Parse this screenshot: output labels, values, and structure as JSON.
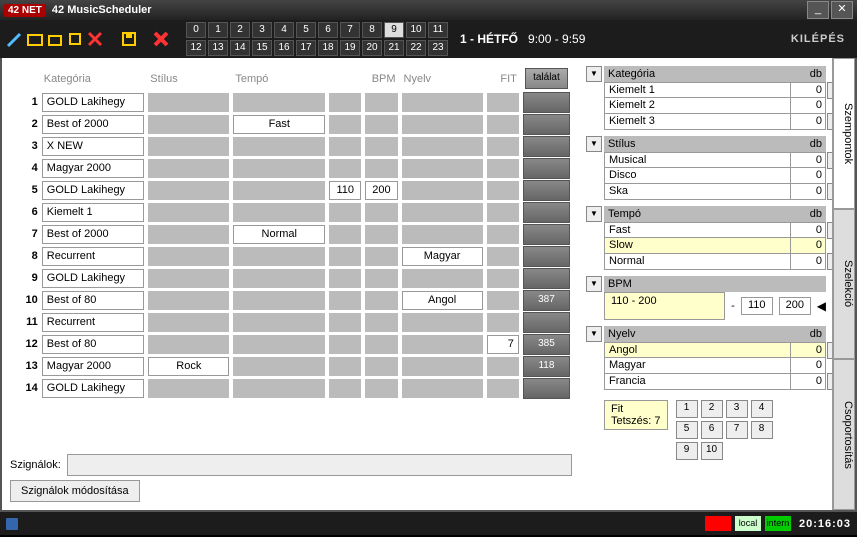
{
  "title": "42 MusicScheduler",
  "logo": "42 NET",
  "toolbar": {
    "exit": "KILÉPÉS"
  },
  "hours": {
    "selected": 9
  },
  "day": {
    "label": "1 - HÉTFŐ",
    "time": "9:00 - 9:59"
  },
  "columns": {
    "kat": "Kategória",
    "stilus": "Stílus",
    "tempo": "Tempó",
    "bpm": "BPM",
    "nyelv": "Nyelv",
    "fit": "FIT"
  },
  "result_header": "találat",
  "rows": [
    {
      "n": 1,
      "kat": "GOLD Lakihegy",
      "stilus": "",
      "tempo": "",
      "bpm": "",
      "bpm2": "",
      "nyelv": "",
      "fit": "",
      "res": ""
    },
    {
      "n": 2,
      "kat": "Best of 2000",
      "stilus": "",
      "tempo": "Fast",
      "bpm": "",
      "bpm2": "",
      "nyelv": "",
      "fit": "",
      "res": ""
    },
    {
      "n": 3,
      "kat": "X NEW",
      "stilus": "",
      "tempo": "",
      "bpm": "",
      "bpm2": "",
      "nyelv": "",
      "fit": "",
      "res": ""
    },
    {
      "n": 4,
      "kat": "Magyar 2000",
      "stilus": "",
      "tempo": "",
      "bpm": "",
      "bpm2": "",
      "nyelv": "",
      "fit": "",
      "res": ""
    },
    {
      "n": 5,
      "kat": "GOLD Lakihegy",
      "stilus": "",
      "tempo": "",
      "bpm": "110",
      "bpm2": "200",
      "nyelv": "",
      "fit": "",
      "res": ""
    },
    {
      "n": 6,
      "kat": "Kiemelt 1",
      "stilus": "",
      "tempo": "",
      "bpm": "",
      "bpm2": "",
      "nyelv": "",
      "fit": "",
      "res": ""
    },
    {
      "n": 7,
      "kat": "Best of 2000",
      "stilus": "",
      "tempo": "Normal",
      "bpm": "",
      "bpm2": "",
      "nyelv": "",
      "fit": "",
      "res": ""
    },
    {
      "n": 8,
      "kat": "Recurrent",
      "stilus": "",
      "tempo": "",
      "bpm": "",
      "bpm2": "",
      "nyelv": "Magyar",
      "fit": "",
      "res": ""
    },
    {
      "n": 9,
      "kat": "GOLD Lakihegy",
      "stilus": "",
      "tempo": "",
      "bpm": "",
      "bpm2": "",
      "nyelv": "",
      "fit": "",
      "res": ""
    },
    {
      "n": 10,
      "kat": "Best of 80",
      "stilus": "",
      "tempo": "",
      "bpm": "",
      "bpm2": "",
      "nyelv": "Angol",
      "fit": "",
      "res": "387"
    },
    {
      "n": 11,
      "kat": "Recurrent",
      "stilus": "",
      "tempo": "",
      "bpm": "",
      "bpm2": "",
      "nyelv": "",
      "fit": "",
      "res": ""
    },
    {
      "n": 12,
      "kat": "Best of 80",
      "stilus": "",
      "tempo": "",
      "bpm": "",
      "bpm2": "",
      "nyelv": "",
      "fit": "7",
      "res": "385"
    },
    {
      "n": 13,
      "kat": "Magyar 2000",
      "stilus": "Rock",
      "tempo": "",
      "bpm": "",
      "bpm2": "",
      "nyelv": "",
      "fit": "",
      "res": "118"
    },
    {
      "n": 14,
      "kat": "GOLD Lakihegy",
      "stilus": "",
      "tempo": "",
      "bpm": "",
      "bpm2": "",
      "nyelv": "",
      "fit": "",
      "res": ""
    }
  ],
  "signals": {
    "label": "Szignálok:",
    "value": "",
    "button": "Szignálok módosítása"
  },
  "panels": {
    "kategoria": {
      "title": "Kategória",
      "db": "db",
      "items": [
        {
          "n": "Kiemelt 1",
          "c": "0"
        },
        {
          "n": "Kiemelt 2",
          "c": "0"
        },
        {
          "n": "Kiemelt 3",
          "c": "0"
        }
      ]
    },
    "stilus": {
      "title": "Stílus",
      "db": "db",
      "items": [
        {
          "n": "Musical",
          "c": "0"
        },
        {
          "n": "Disco",
          "c": "0"
        },
        {
          "n": "Ska",
          "c": "0"
        }
      ]
    },
    "tempo": {
      "title": "Tempó",
      "db": "db",
      "items": [
        {
          "n": "Fast",
          "c": "0"
        },
        {
          "n": "Slow",
          "c": "0",
          "hl": true
        },
        {
          "n": "Normal",
          "c": "0"
        }
      ]
    },
    "bpm": {
      "title": "BPM",
      "range": "110 - 200",
      "sep": "-",
      "v1": "110",
      "v2": "200"
    },
    "nyelv": {
      "title": "Nyelv",
      "db": "db",
      "items": [
        {
          "n": "Angol",
          "c": "0",
          "hl": true
        },
        {
          "n": "Magyar",
          "c": "0"
        },
        {
          "n": "Francia",
          "c": "0"
        }
      ]
    },
    "fit": {
      "title": "Fit",
      "val": "Tetszés: 7",
      "nums": [
        "1",
        "2",
        "3",
        "4",
        "5",
        "6",
        "7",
        "8",
        "9",
        "10"
      ]
    }
  },
  "tabs": [
    "Szempontok",
    "Szelekció",
    "Csoportosítás"
  ],
  "status": {
    "local": "local",
    "intern": "intern",
    "clock": "20:16:03"
  }
}
